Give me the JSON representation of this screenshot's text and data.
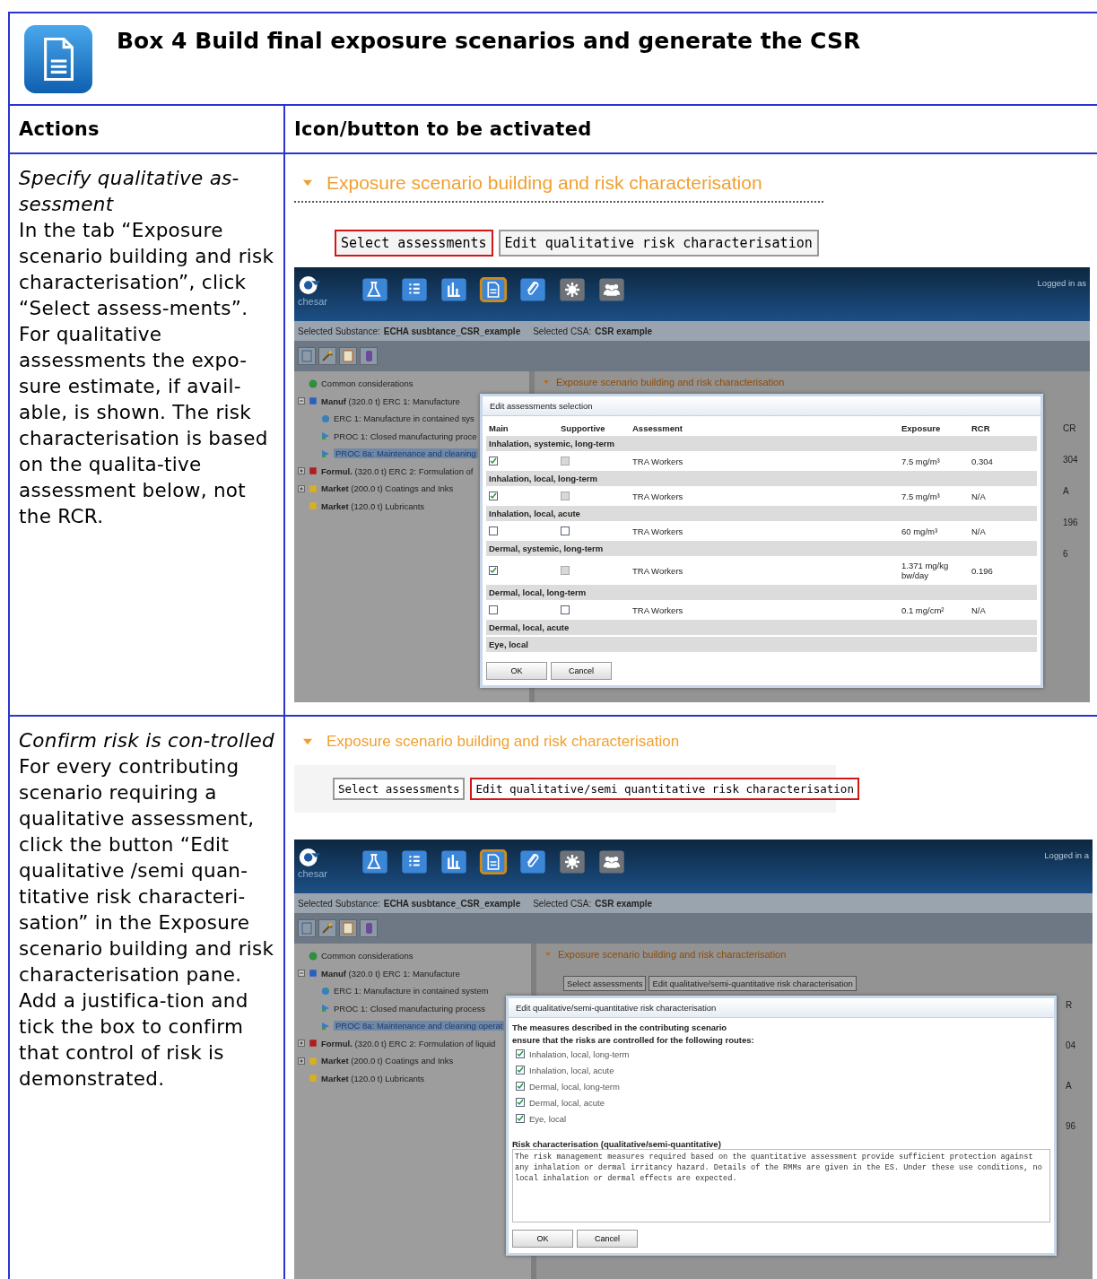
{
  "box": {
    "title": "Box 4 Build final exposure scenarios and generate the CSR"
  },
  "columns": [
    "Actions",
    "Icon/button to be activated"
  ],
  "rows": [
    {
      "action_title": "Specify qualitative as-sessment",
      "action_text": "In the tab “Exposure scenario building and risk characterisation”, click “Select assess-ments”. For qualitative assessments the expo-sure estimate, if avail-able, is shown. The risk characterisation is based on the qualita-tive assessment below, not the RCR.",
      "panel": {
        "title": "Exposure scenario building and risk characterisation",
        "buttons": [
          {
            "label": "Select assessments",
            "highlighted": true
          },
          {
            "label": "Edit qualitative risk characterisation",
            "highlighted": false
          }
        ]
      },
      "screenshot": {
        "logo": "chesar",
        "logged_in": "Logged in as",
        "nav": [
          {
            "selected": false
          },
          {
            "selected": false
          },
          {
            "selected": false
          },
          {
            "selected": true
          },
          {
            "selected": false
          },
          {
            "selected": false
          },
          {
            "selected": false
          }
        ],
        "substance_label": "Selected Substance:",
        "substance": "ECHA susbtance_CSR_example",
        "csa_label": "Selected CSA:",
        "csa": "CSR example",
        "tree": [
          {
            "kind": "general",
            "name": "Common considerations",
            "color": "#2f8f3f"
          },
          {
            "kind": "group",
            "name": "Manuf",
            "detail": "(320.0 t) ERC 1: Manufacture",
            "color": "#2a5fc0",
            "expanded": true,
            "children": [
              {
                "kind": "erc",
                "label": "ERC 1: Manufacture in contained sys",
                "selected": false
              },
              {
                "kind": "proc",
                "label": "PROC 1: Closed manufacturing proce",
                "selected": false
              },
              {
                "kind": "proc",
                "label": "PROC 8a: Maintenance and cleaning",
                "selected": true
              }
            ]
          },
          {
            "kind": "group",
            "name": "Formul.",
            "detail": "(320.0 t) ERC 2: Formulation of",
            "color": "#b01c1c",
            "expanded": false
          },
          {
            "kind": "group",
            "name": "Market",
            "detail": "(200.0 t) Coatings and Inks",
            "color": "#d8b020",
            "expanded": false
          },
          {
            "kind": "plain",
            "name": "Market",
            "detail": "(120.0 t) Lubricants",
            "color": "#d8b020"
          }
        ],
        "main_title": "Exposure scenario building and risk characterisation",
        "behind_texts": [
          "CR",
          "304",
          "A",
          "196",
          "6"
        ],
        "dialog": {
          "kind": "assessments",
          "title": "Edit assessments selection",
          "columns": [
            "Main",
            "Supportive",
            "Assessment",
            "Exposure",
            "RCR"
          ],
          "groups": [
            {
              "name": "Inhalation, systemic, long-term",
              "rows": [
                {
                  "main": true,
                  "supportive": false,
                  "supportive_disabled": true,
                  "assessment": "TRA Workers",
                  "exposure": "7.5 mg/m³",
                  "rcr": "0.304"
                }
              ]
            },
            {
              "name": "Inhalation, local, long-term",
              "rows": [
                {
                  "main": true,
                  "supportive": false,
                  "supportive_disabled": true,
                  "assessment": "TRA Workers",
                  "exposure": "7.5 mg/m³",
                  "rcr": "N/A"
                }
              ]
            },
            {
              "name": "Inhalation, local, acute",
              "rows": [
                {
                  "main": false,
                  "supportive": false,
                  "supportive_disabled": false,
                  "assessment": "TRA Workers",
                  "exposure": "60 mg/m³",
                  "rcr": "N/A"
                }
              ]
            },
            {
              "name": "Dermal, systemic, long-term",
              "rows": [
                {
                  "main": true,
                  "supportive": false,
                  "supportive_disabled": true,
                  "assessment": "TRA Workers",
                  "exposure": "1.371 mg/kg bw/day",
                  "rcr": "0.196"
                }
              ]
            },
            {
              "name": "Dermal, local, long-term",
              "rows": [
                {
                  "main": false,
                  "supportive": false,
                  "supportive_disabled": false,
                  "assessment": "TRA Workers",
                  "exposure": "0.1 mg/cm²",
                  "rcr": "N/A"
                }
              ]
            },
            {
              "name": "Dermal, local, acute"
            },
            {
              "name": "Eye, local"
            }
          ],
          "buttons": [
            "OK",
            "Cancel"
          ]
        }
      }
    },
    {
      "action_title": "Confirm risk is con-trolled",
      "action_text": "For every contributing scenario requiring a qualitative assessment, click the button “Edit qualitative /semi quan-titative risk characteri-sation” in the Exposure scenario building and risk characterisation pane. Add a justifica-tion and tick the box to confirm that control of risk is demonstrated.",
      "panel": {
        "title": "Exposure scenario building and risk characterisation",
        "buttons": [
          {
            "label": "Select assessments",
            "highlighted": false
          },
          {
            "label": "Edit qualitative/semi quantitative risk characterisation",
            "highlighted": true
          }
        ]
      },
      "screenshot": {
        "logo": "chesar",
        "logged_in": "Logged in a",
        "nav": [
          {
            "selected": false
          },
          {
            "selected": false
          },
          {
            "selected": false
          },
          {
            "selected": true
          },
          {
            "selected": false
          },
          {
            "selected": false
          },
          {
            "selected": false
          }
        ],
        "substance_label": "Selected Substance:",
        "substance": "ECHA susbtance_CSR_example",
        "csa_label": "Selected CSA:",
        "csa": "CSR example",
        "tree": [
          {
            "kind": "general",
            "name": "Common considerations",
            "color": "#2f8f3f"
          },
          {
            "kind": "group",
            "name": "Manuf",
            "detail": "(320.0 t) ERC 1: Manufacture",
            "color": "#2a5fc0",
            "expanded": true,
            "children": [
              {
                "kind": "erc",
                "label": "ERC 1: Manufacture in contained system",
                "selected": false
              },
              {
                "kind": "proc",
                "label": "PROC 1: Closed manufacturing process",
                "selected": false
              },
              {
                "kind": "proc",
                "label": "PROC 8a: Maintenance and cleaning operat",
                "selected": true
              }
            ]
          },
          {
            "kind": "group",
            "name": "Formul.",
            "detail": "(320.0 t) ERC 2: Formulation of liquid",
            "color": "#b01c1c",
            "expanded": false
          },
          {
            "kind": "group",
            "name": "Market",
            "detail": "(200.0 t) Coatings and Inks",
            "color": "#d8b020",
            "expanded": false
          },
          {
            "kind": "plain",
            "name": "Market",
            "detail": "(120.0 t) Lubricants",
            "color": "#d8b020"
          }
        ],
        "main_title": "Exposure scenario building and risk characterisation",
        "main_tabs": [
          "Select assessments",
          "Edit qualitative/semi-quantitative risk characterisation"
        ],
        "behind_texts": [
          "R",
          "04",
          "A",
          "96"
        ],
        "dialog": {
          "kind": "qualitative",
          "title": "Edit qualitative/semi-quantitative risk characterisation",
          "intro": "The measures described in the contributing scenario ensure that the risks are controlled for the following routes:",
          "routes": [
            {
              "label": "Inhalation, local, long-term",
              "checked": true
            },
            {
              "label": "Inhalation, local, acute",
              "checked": true
            },
            {
              "label": "Dermal, local, long-term",
              "checked": true
            },
            {
              "label": "Dermal, local, acute",
              "checked": true
            },
            {
              "label": "Eye, local",
              "checked": true
            }
          ],
          "field_label": "Risk characterisation (qualitative/semi-quantitative)",
          "value": "The risk management measures required based on the quantitative assessment provide sufficient protection against any inhalation or dermal irritancy hazard. Details of the RMMs are given in the ES. Under these use conditions, no local inhalation or dermal effects are expected.",
          "buttons": [
            "OK",
            "Cancel"
          ]
        }
      }
    }
  ]
}
